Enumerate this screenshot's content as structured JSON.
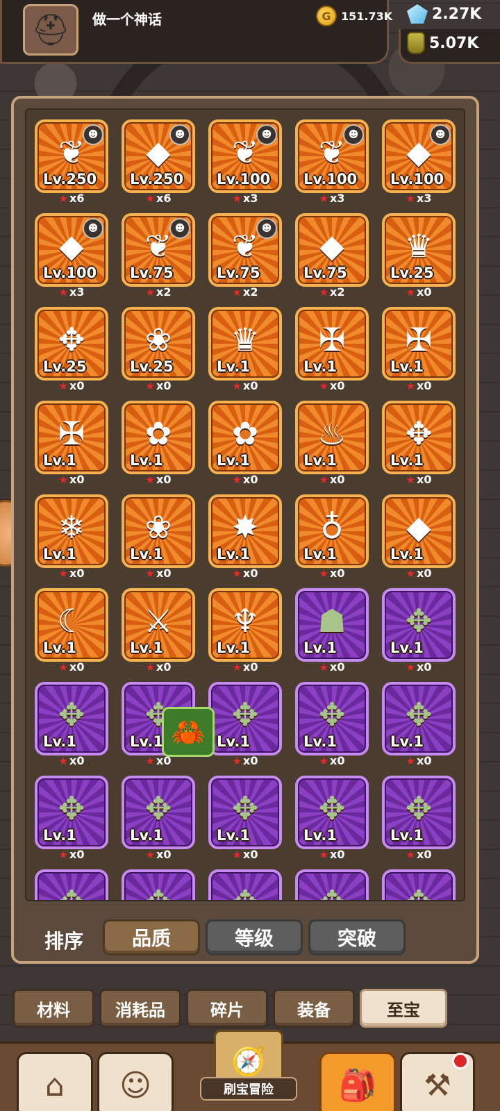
{
  "header": {
    "player_name": "做一个神话",
    "gold": "151.73K",
    "gems": "2.27K",
    "potions": "5.07K"
  },
  "items": [
    {
      "rarity": "orange",
      "icon": "wings-icon",
      "glyph": "❦",
      "level": "Lv.250",
      "stars": "x6",
      "hero": true
    },
    {
      "rarity": "orange",
      "icon": "spear-crystal-icon",
      "glyph": "◆",
      "level": "Lv.250",
      "stars": "x6",
      "hero": true
    },
    {
      "rarity": "orange",
      "icon": "wings-icon",
      "glyph": "❦",
      "level": "Lv.100",
      "stars": "x3",
      "hero": true
    },
    {
      "rarity": "orange",
      "icon": "wings-icon",
      "glyph": "❦",
      "level": "Lv.100",
      "stars": "x3",
      "hero": true
    },
    {
      "rarity": "orange",
      "icon": "spear-crystal-icon",
      "glyph": "◆",
      "level": "Lv.100",
      "stars": "x3",
      "hero": true
    },
    {
      "rarity": "orange",
      "icon": "spear-crystal-icon",
      "glyph": "◆",
      "level": "Lv.100",
      "stars": "x3",
      "hero": true
    },
    {
      "rarity": "orange",
      "icon": "wings-icon",
      "glyph": "❦",
      "level": "Lv.75",
      "stars": "x2",
      "hero": true
    },
    {
      "rarity": "orange",
      "icon": "wings-icon",
      "glyph": "❦",
      "level": "Lv.75",
      "stars": "x2",
      "hero": true
    },
    {
      "rarity": "orange",
      "icon": "spear-crystal-icon",
      "glyph": "◆",
      "level": "Lv.75",
      "stars": "x2",
      "hero": false
    },
    {
      "rarity": "orange",
      "icon": "dragon-helm-icon",
      "glyph": "♛",
      "level": "Lv.25",
      "stars": "x0",
      "hero": false
    },
    {
      "rarity": "orange",
      "icon": "green-horn-emblem-icon",
      "glyph": "✥",
      "level": "Lv.25",
      "stars": "x0",
      "hero": false
    },
    {
      "rarity": "orange",
      "icon": "leaf-orb-icon",
      "glyph": "❀",
      "level": "Lv.25",
      "stars": "x0",
      "hero": false
    },
    {
      "rarity": "orange",
      "icon": "dragon-helm-icon",
      "glyph": "♛",
      "level": "Lv.1",
      "stars": "x0",
      "hero": false
    },
    {
      "rarity": "orange",
      "icon": "golden-cross-shield-icon",
      "glyph": "✠",
      "level": "Lv.1",
      "stars": "x0",
      "hero": false
    },
    {
      "rarity": "orange",
      "icon": "golden-cross-shield-icon",
      "glyph": "✠",
      "level": "Lv.1",
      "stars": "x0",
      "hero": false
    },
    {
      "rarity": "orange",
      "icon": "golden-cross-shield-icon",
      "glyph": "✠",
      "level": "Lv.1",
      "stars": "x0",
      "hero": false
    },
    {
      "rarity": "orange",
      "icon": "pink-flower-icon",
      "glyph": "✿",
      "level": "Lv.1",
      "stars": "x0",
      "hero": false
    },
    {
      "rarity": "orange",
      "icon": "pink-flower-icon",
      "glyph": "✿",
      "level": "Lv.1",
      "stars": "x0",
      "hero": false
    },
    {
      "rarity": "orange",
      "icon": "flame-icon",
      "glyph": "♨",
      "level": "Lv.1",
      "stars": "x0",
      "hero": false
    },
    {
      "rarity": "orange",
      "icon": "green-horn-emblem-icon",
      "glyph": "✥",
      "level": "Lv.1",
      "stars": "x0",
      "hero": false
    },
    {
      "rarity": "orange",
      "icon": "snowflake-hexagon-icon",
      "glyph": "❄",
      "level": "Lv.1",
      "stars": "x0",
      "hero": false
    },
    {
      "rarity": "orange",
      "icon": "leaf-orb-icon",
      "glyph": "❀",
      "level": "Lv.1",
      "stars": "x0",
      "hero": false
    },
    {
      "rarity": "orange",
      "icon": "star-diamond-icon",
      "glyph": "✸",
      "level": "Lv.1",
      "stars": "x0",
      "hero": false
    },
    {
      "rarity": "orange",
      "icon": "purple-orb-scepter-icon",
      "glyph": "♁",
      "level": "Lv.1",
      "stars": "x0",
      "hero": false
    },
    {
      "rarity": "orange",
      "icon": "spear-crystal-icon",
      "glyph": "◆",
      "level": "Lv.1",
      "stars": "x0",
      "hero": false
    },
    {
      "rarity": "orange",
      "icon": "crescent-moon-icon",
      "glyph": "☾",
      "level": "Lv.1",
      "stars": "x0",
      "hero": false
    },
    {
      "rarity": "orange",
      "icon": "sword-shield-icon",
      "glyph": "⚔",
      "level": "Lv.1",
      "stars": "x0",
      "hero": false
    },
    {
      "rarity": "orange",
      "icon": "golden-blade-icon",
      "glyph": "♆",
      "level": "Lv.1",
      "stars": "x0",
      "hero": false
    },
    {
      "rarity": "purple",
      "icon": "jade-mask-icon",
      "glyph": "☗",
      "level": "Lv.1",
      "stars": "x0",
      "hero": false
    },
    {
      "rarity": "purple",
      "icon": "jade-emblem-icon",
      "glyph": "✥",
      "level": "Lv.1",
      "stars": "x0",
      "hero": false
    },
    {
      "rarity": "purple",
      "icon": "jade-emblem-icon",
      "glyph": "✥",
      "level": "Lv.1",
      "stars": "x0",
      "hero": false
    },
    {
      "rarity": "purple",
      "icon": "jade-emblem-icon",
      "glyph": "✥",
      "level": "Lv.1",
      "stars": "x0",
      "hero": false
    },
    {
      "rarity": "purple",
      "icon": "jade-emblem-icon",
      "glyph": "✥",
      "level": "Lv.1",
      "stars": "x0",
      "hero": false
    },
    {
      "rarity": "purple",
      "icon": "jade-emblem-icon",
      "glyph": "✥",
      "level": "Lv.1",
      "stars": "x0",
      "hero": false
    },
    {
      "rarity": "purple",
      "icon": "jade-emblem-icon",
      "glyph": "✥",
      "level": "Lv.1",
      "stars": "x0",
      "hero": false
    },
    {
      "rarity": "purple",
      "icon": "jade-emblem-icon",
      "glyph": "✥",
      "level": "Lv.1",
      "stars": "x0",
      "hero": false
    },
    {
      "rarity": "purple",
      "icon": "jade-emblem-icon",
      "glyph": "✥",
      "level": "Lv.1",
      "stars": "x0",
      "hero": false
    },
    {
      "rarity": "purple",
      "icon": "jade-emblem-icon",
      "glyph": "✥",
      "level": "Lv.1",
      "stars": "x0",
      "hero": false
    },
    {
      "rarity": "purple",
      "icon": "jade-emblem-icon",
      "glyph": "✥",
      "level": "Lv.1",
      "stars": "x0",
      "hero": false
    },
    {
      "rarity": "purple",
      "icon": "jade-emblem-icon",
      "glyph": "✥",
      "level": "Lv.1",
      "stars": "x0",
      "hero": false
    },
    {
      "rarity": "purple",
      "icon": "jade-emblem-icon",
      "glyph": "✥",
      "level": "",
      "stars": "",
      "hero": false
    },
    {
      "rarity": "purple",
      "icon": "jade-emblem-icon",
      "glyph": "✥",
      "level": "",
      "stars": "",
      "hero": false
    },
    {
      "rarity": "purple",
      "icon": "jade-emblem-icon",
      "glyph": "✥",
      "level": "",
      "stars": "",
      "hero": false
    },
    {
      "rarity": "purple",
      "icon": "jade-emblem-icon",
      "glyph": "✥",
      "level": "",
      "stars": "",
      "hero": false
    },
    {
      "rarity": "purple",
      "icon": "jade-emblem-icon",
      "glyph": "✥",
      "level": "",
      "stars": "",
      "hero": false
    }
  ],
  "sort": {
    "label": "排序",
    "options": [
      "品质",
      "等级",
      "突破"
    ],
    "active_index": 0
  },
  "tabs": {
    "items": [
      "材料",
      "消耗品",
      "碎片",
      "装备",
      "至宝"
    ],
    "active_index": 4
  },
  "bottom_nav": {
    "adventure_label": "刷宝冒险"
  },
  "colors": {
    "orange_rarity": "#f08a2a",
    "purple_rarity": "#8b3fc2",
    "star": "#e8282a"
  }
}
